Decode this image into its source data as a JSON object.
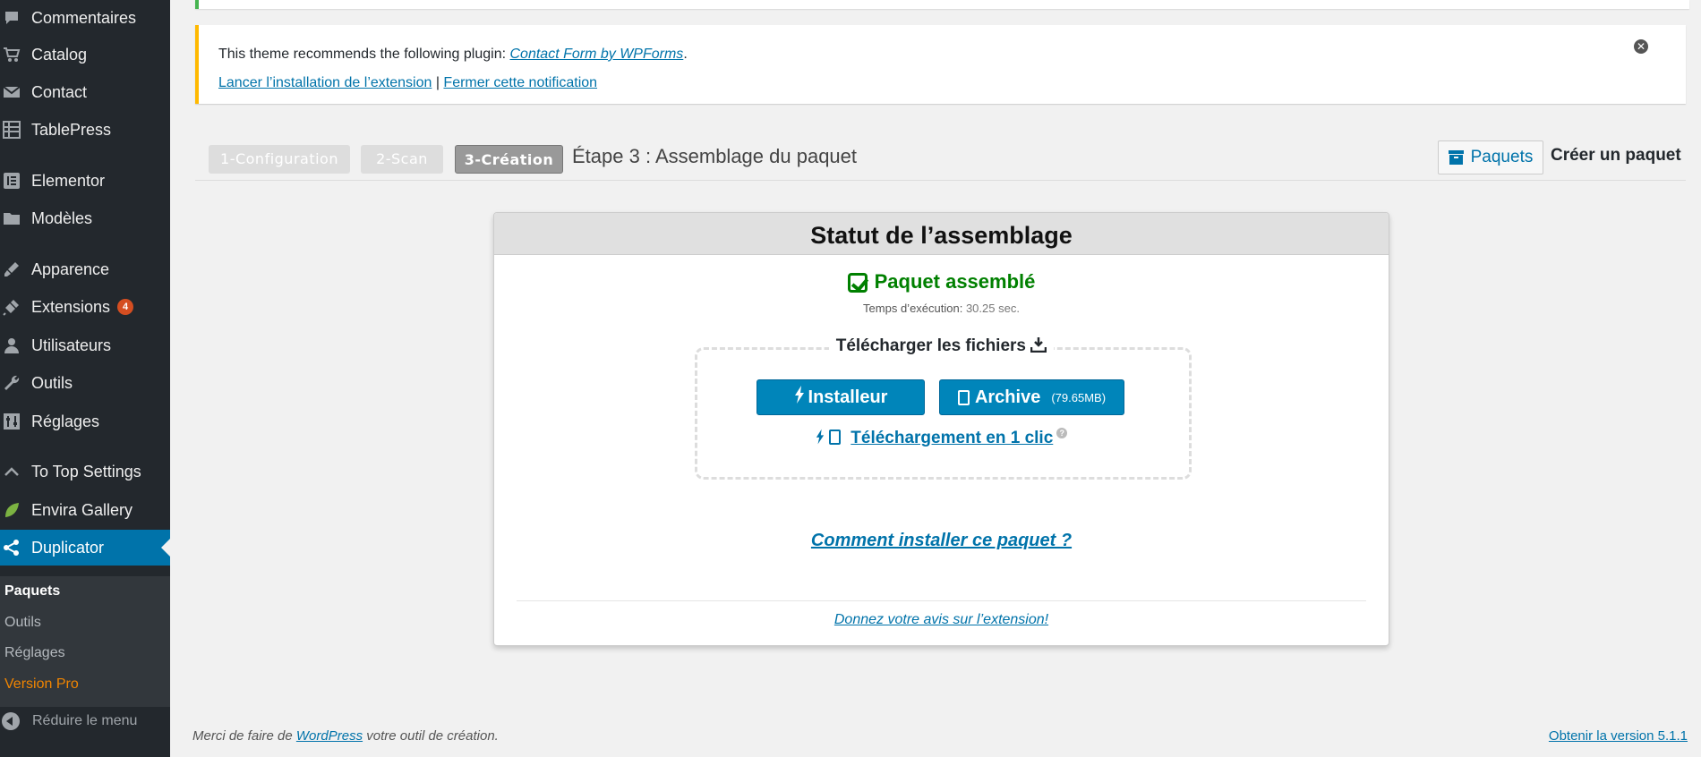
{
  "sidebar": {
    "items": [
      {
        "label": "Commentaires",
        "icon": "comment-icon"
      },
      {
        "label": "Catalog",
        "icon": "cart-icon"
      },
      {
        "label": "Contact",
        "icon": "mail-icon"
      },
      {
        "label": "TablePress",
        "icon": "table-icon"
      },
      {
        "label": "Elementor",
        "icon": "elementor-icon"
      },
      {
        "label": "Modèles",
        "icon": "folder-icon"
      },
      {
        "label": "Apparence",
        "icon": "brush-icon"
      },
      {
        "label": "Extensions",
        "icon": "plugin-icon",
        "badge": "4"
      },
      {
        "label": "Utilisateurs",
        "icon": "user-icon"
      },
      {
        "label": "Outils",
        "icon": "wrench-icon"
      },
      {
        "label": "Réglages",
        "icon": "sliders-icon"
      },
      {
        "label": "To Top Settings",
        "icon": "chevron-up-icon"
      },
      {
        "label": "Envira Gallery",
        "icon": "leaf-icon"
      },
      {
        "label": "Duplicator",
        "icon": "share-icon"
      }
    ],
    "submenu": [
      "Paquets",
      "Outils",
      "Réglages",
      "Version Pro"
    ],
    "collapse_label": "Réduire le menu"
  },
  "notice": {
    "text": "This theme recommends the following plugin: ",
    "plugin_link": "Contact Form by WPForms",
    "period": ".",
    "install_link": "Lancer l’installation de l’extension",
    "separator": " | ",
    "dismiss_link": "Fermer cette notification"
  },
  "steps": {
    "items": [
      "1-Configuration",
      "2-Scan",
      "3-Création"
    ],
    "title": "Étape 3 : Assemblage du paquet"
  },
  "toolbar": {
    "packages_button": "Paquets",
    "create_label": "Créer un paquet"
  },
  "panel": {
    "header": "Statut de l’assemblage",
    "status": "Paquet assemblé",
    "exec_label": "Temps d’exécution:",
    "exec_value": "30.25 sec.",
    "download_legend": "Télécharger les fichiers",
    "installer_button": "Installeur",
    "archive_button": "Archive",
    "archive_size": "(79.65MB)",
    "one_click": "Téléchargement en 1 clic",
    "how_install": "Comment installer ce paquet ?",
    "feedback": "Donnez votre avis sur l’extension!"
  },
  "footer": {
    "left_prefix": "Merci de faire de ",
    "left_link": "WordPress",
    "left_suffix": " votre outil de création.",
    "version_link": "Obtenir la version 5.1.1"
  },
  "colors": {
    "sidebar_bg": "#23282d",
    "active_bg": "#0073aa",
    "button_blue": "#0085ba",
    "success_green": "#008000",
    "notice_warning": "#ffb900",
    "notice_success": "#46b450",
    "pro_orange": "#f18500"
  }
}
